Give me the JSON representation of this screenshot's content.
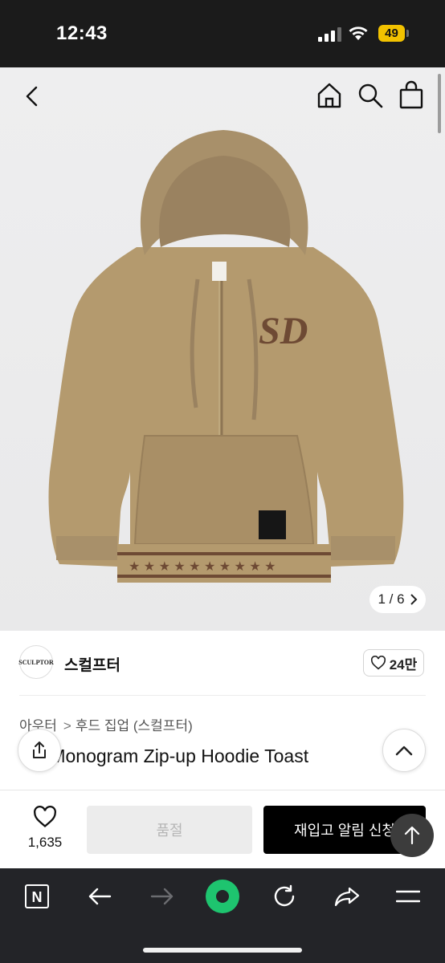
{
  "status_bar": {
    "time": "12:43",
    "battery": "49"
  },
  "product": {
    "page_indicator": "1 / 6",
    "brand_name": "스컬프터",
    "brand_logo_text": "SCULPTOR",
    "brand_likes": "24만",
    "breadcrumb": [
      "아우터",
      "후드 집업 (스컬프터)"
    ],
    "title": "SD Monogram Zip-up Hoodie Toast",
    "wish_count": "1,635"
  },
  "actions": {
    "soldout_label": "품절",
    "restock_label": "재입고 알림 신청"
  },
  "icons": {
    "back": "chevron-left-icon",
    "home": "home-icon",
    "search": "search-icon",
    "bag": "shopping-bag-icon",
    "share": "share-icon",
    "collapse": "chevron-up-icon",
    "scroll_top": "arrow-up-icon",
    "heart": "heart-icon"
  },
  "browser": {
    "app_icon_letter": "N"
  },
  "colors": {
    "accent_green": "#1ec46f",
    "hoodie": "#b49a6e",
    "toolbar": "#232428"
  }
}
